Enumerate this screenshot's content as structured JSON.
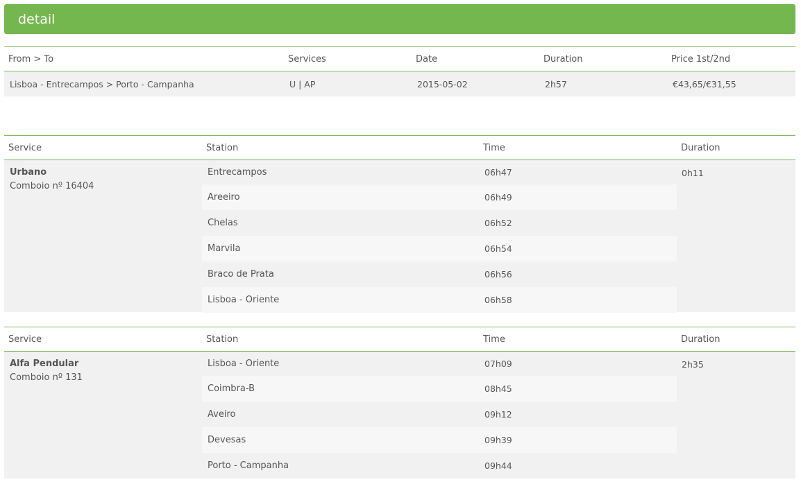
{
  "header": {
    "title": "detail"
  },
  "summary": {
    "columns": [
      "From > To",
      "Services",
      "Date",
      "Duration",
      "Price 1st/2nd"
    ],
    "row": {
      "route": "Lisboa - Entrecampos > Porto - Campanha",
      "services": "U | AP",
      "date": "2015-05-02",
      "duration": "2h57",
      "price": "€43,65/€31,55"
    }
  },
  "legs": [
    {
      "columns": [
        "Service",
        "Station",
        "Time",
        "Duration"
      ],
      "service_name": "Urbano",
      "train": "Comboio nº 16404",
      "duration": "0h11",
      "stops": [
        {
          "station": "Entrecampos",
          "time": "06h47"
        },
        {
          "station": "Areeiro",
          "time": "06h49"
        },
        {
          "station": "Chelas",
          "time": "06h52"
        },
        {
          "station": "Marvila",
          "time": "06h54"
        },
        {
          "station": "Braco de Prata",
          "time": "06h56"
        },
        {
          "station": "Lisboa - Oriente",
          "time": "06h58"
        }
      ]
    },
    {
      "columns": [
        "Service",
        "Station",
        "Time",
        "Duration"
      ],
      "service_name": "Alfa Pendular",
      "train": "Comboio nº 131",
      "duration": "2h35",
      "stops": [
        {
          "station": "Lisboa - Oriente",
          "time": "07h09"
        },
        {
          "station": "Coimbra-B",
          "time": "08h45"
        },
        {
          "station": "Aveiro",
          "time": "09h12"
        },
        {
          "station": "Devesas",
          "time": "09h39"
        },
        {
          "station": "Porto - Campanha",
          "time": "09h44"
        }
      ]
    }
  ]
}
